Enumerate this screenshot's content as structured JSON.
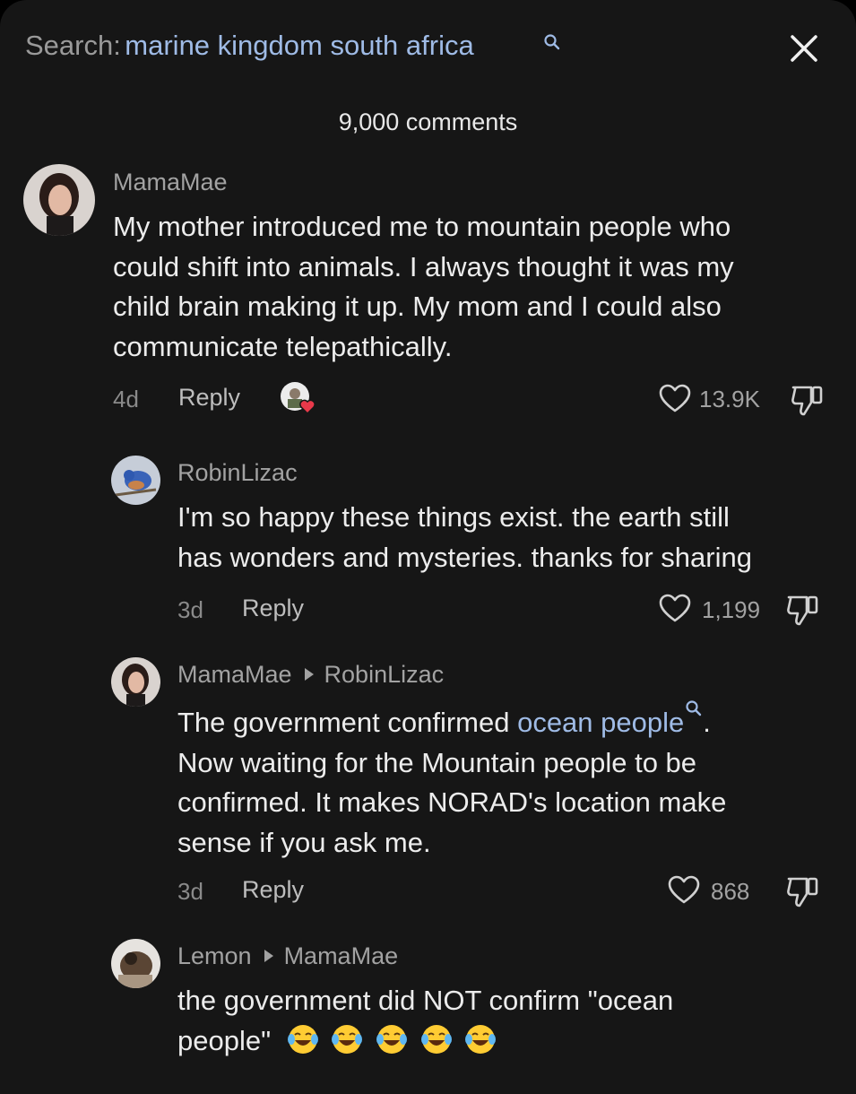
{
  "search": {
    "prefix": "Search:",
    "query": "marine kingdom south africa"
  },
  "comments_count": "9,000 comments",
  "comments": [
    {
      "username": "MamaMae",
      "text": [
        "My mother introduced me to mountain people who",
        "could shift into animals. I always thought it was my",
        "child brain making it up. My mom and I could also",
        "communicate telepathically."
      ],
      "age": "4d",
      "reply_label": "Reply",
      "likes": "13.9K"
    },
    {
      "username": "RobinLizac",
      "text": [
        "I'm so happy these things exist. the earth still",
        "has wonders and mysteries. thanks for sharing"
      ],
      "age": "3d",
      "reply_label": "Reply",
      "likes": "1,199"
    },
    {
      "username": "MamaMae",
      "reply_to": "RobinLizac",
      "text_before_link": "The government confirmed ",
      "link_text": "ocean people",
      "text_after_link": ".",
      "text": [
        "Now waiting for the Mountain people to be",
        "confirmed. It makes NORAD's location make",
        "sense if you ask me."
      ],
      "age": "3d",
      "reply_label": "Reply",
      "likes": "868"
    },
    {
      "username": "Lemon",
      "reply_to": "MamaMae",
      "text": [
        "the government did NOT confirm \"ocean",
        "people\""
      ]
    }
  ],
  "colors": {
    "background": "#161616",
    "link": "#9fbbe6",
    "text": "#ececec",
    "muted": "#a2a2a2",
    "heart_badge": "#e8394a"
  },
  "icons": [
    "search-icon",
    "close-icon",
    "heart-icon",
    "dislike-icon",
    "creator-liked-badge",
    "laughing-emoji"
  ]
}
